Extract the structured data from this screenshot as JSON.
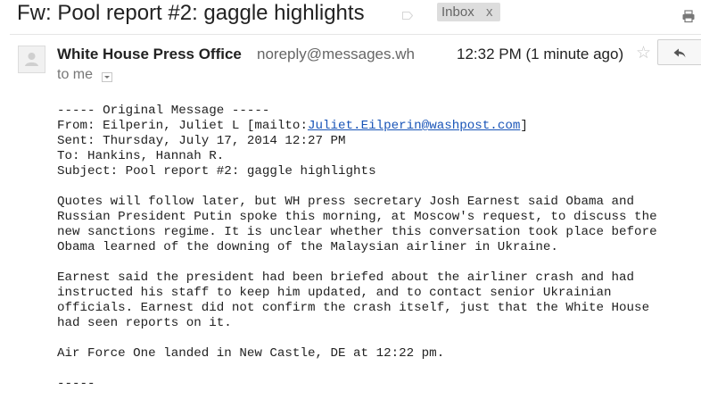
{
  "header": {
    "subject": "Fw: Pool report #2: gaggle highlights",
    "label": "Inbox",
    "label_remove": "x"
  },
  "message": {
    "sender_name": "White House Press Office",
    "sender_email": "noreply@messages.wh",
    "timestamp": "12:32 PM (1 minute ago)",
    "to_label": "to me",
    "star_glyph": "☆"
  },
  "body": {
    "original_header": "----- Original Message -----",
    "from_prefix": "From: Eilperin, Juliet L [mailto:",
    "from_email": "Juliet.Eilperin@washpost.com",
    "from_suffix": "]",
    "sent": "Sent: Thursday, July 17, 2014 12:27 PM",
    "to": "To: Hankins, Hannah R.",
    "subject": "Subject: Pool report #2: gaggle highlights",
    "paragraph1": [
      "Quotes will follow later, but WH press secretary Josh Earnest said Obama and",
      "Russian President Putin spoke this morning, at Moscow's request, to discuss the",
      "new sanctions regime. It is unclear whether this conversation took place before",
      "Obama learned of the downing of the Malaysian airliner in Ukraine."
    ],
    "paragraph2": [
      "Earnest said the president had been briefed about the airliner crash and had",
      "instructed his staff to keep him updated, and to contact senior Ukrainian",
      "officials. Earnest did not confirm the crash itself, just that the White House",
      "had seen reports on it."
    ],
    "paragraph3": "Air Force One landed in New Castle, DE at 12:22 pm.",
    "footer": "-----"
  },
  "icons": {
    "print": "print-icon",
    "reply": "reply-icon",
    "avatar": "avatar-icon",
    "label_tag": "label-tag-icon",
    "star": "star-icon"
  },
  "colors": {
    "link": "#1a55b8",
    "label_bg": "#dddddd",
    "secondary_text": "#666666"
  }
}
